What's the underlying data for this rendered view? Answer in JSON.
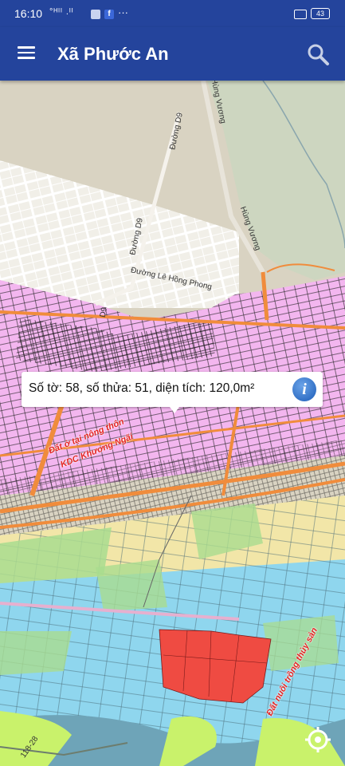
{
  "status_bar": {
    "time": "16:10",
    "signal": "°ᴴᴵᴵ .ᴵᴵ",
    "fb": "f",
    "more": "···",
    "battery": "43"
  },
  "app_bar": {
    "title": "Xã Phước An",
    "menu_icon": "hamburger-menu-icon",
    "search_icon": "search-icon"
  },
  "map": {
    "street_labels": {
      "d9_a": "Đường D9",
      "d9_b": "Đường D9",
      "d9_c": "D9",
      "hung_vuong_a": "Hùng Vương",
      "hung_vuong_b": "Hùng Vương",
      "le_hong_phong": "Đường Lê Hồng Phong",
      "road_code": "118-28"
    },
    "zone_labels": {
      "rural_line1": "Đất ở tại nông thôn",
      "rural_line2": "KDC Khương Ngãi",
      "aquaculture": "Đất nuôi trồng thủy sản"
    },
    "colors": {
      "residential": "#f3b6ef",
      "road": "#f08c3c",
      "aquaculture": "#8fd6ee",
      "agriculture": "#f2e6a8",
      "crop": "#a9dc8f",
      "selected_zone": "#ef4b42",
      "river": "#6ea4b8",
      "base": "#d9d3c2"
    },
    "locate_icon": "my-location-icon"
  },
  "popup": {
    "text": "Số tờ: 58, số thửa: 51, diện tích: 120,0m²",
    "info_icon": "info-icon",
    "info_glyph": "i"
  }
}
